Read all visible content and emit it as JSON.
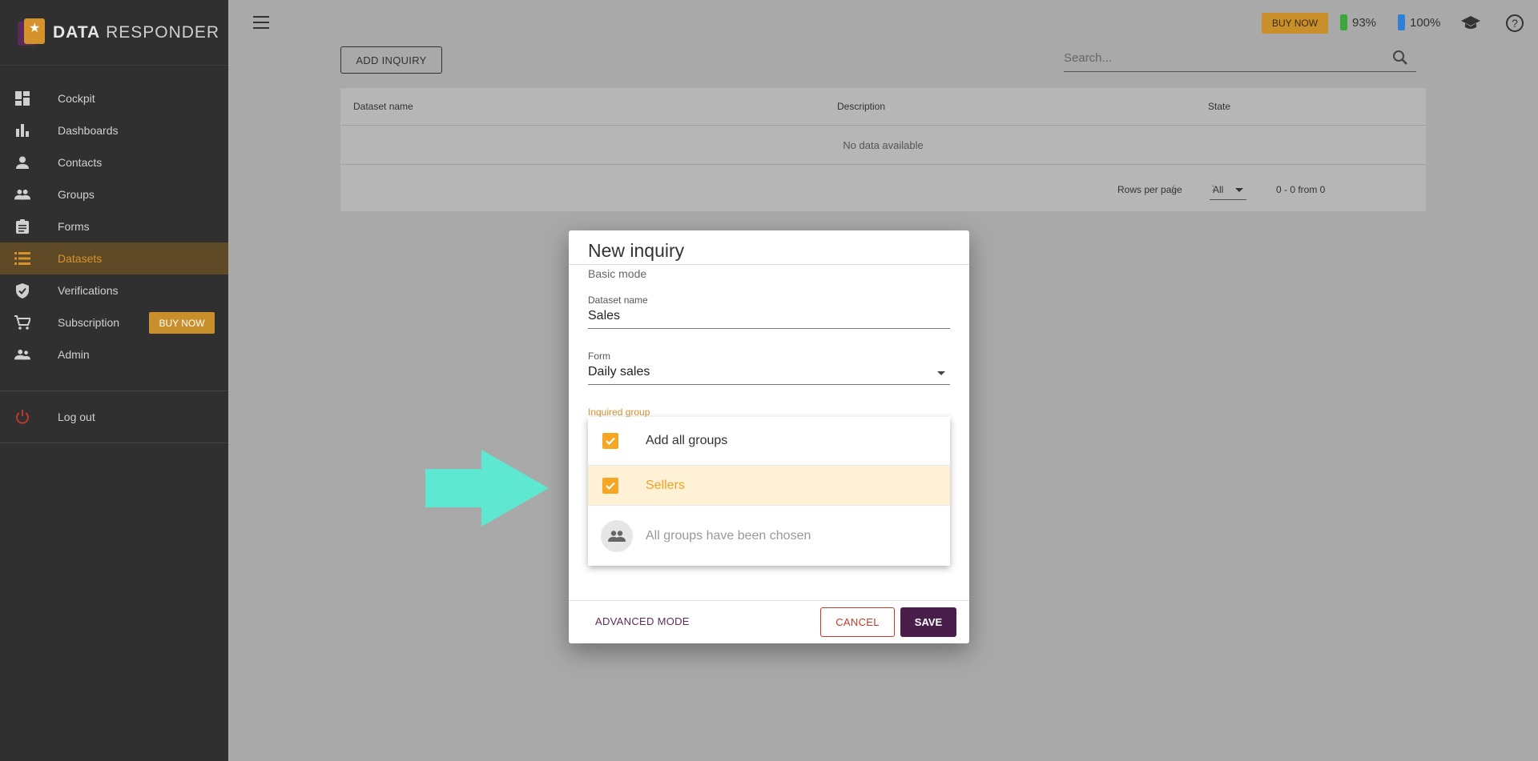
{
  "app": {
    "logo_bold": "DATA",
    "logo_light": "RESPONDER"
  },
  "sidebar": {
    "items": [
      {
        "label": "Cockpit",
        "icon": "dashboard-icon"
      },
      {
        "label": "Dashboards",
        "icon": "bar-chart-icon"
      },
      {
        "label": "Contacts",
        "icon": "person-icon"
      },
      {
        "label": "Groups",
        "icon": "people-icon"
      },
      {
        "label": "Forms",
        "icon": "clipboard-icon"
      },
      {
        "label": "Datasets",
        "icon": "list-icon",
        "active": true
      },
      {
        "label": "Verifications",
        "icon": "shield-check-icon"
      },
      {
        "label": "Subscription",
        "icon": "cart-icon"
      },
      {
        "label": "Admin",
        "icon": "admin-people-icon"
      }
    ],
    "subscription_buy": "BUY NOW",
    "logout": "Log out"
  },
  "topbar": {
    "buy_now": "BUY NOW",
    "battery1": "93%",
    "battery2": "100%",
    "battery1_color": "#3aa83a",
    "battery2_color": "#2f7fd8"
  },
  "main": {
    "add_inquiry": "ADD INQUIRY",
    "search_placeholder": "Search...",
    "table": {
      "columns": [
        "Dataset name",
        "Description",
        "State"
      ],
      "empty": "No data available",
      "rows_per_page_label": "Rows per page",
      "rows_per_page_value": "All",
      "range": "0 - 0 from 0"
    }
  },
  "dialog": {
    "title": "New inquiry",
    "mode": "Basic mode",
    "dataset_name_label": "Dataset name",
    "dataset_name_value": "Sales",
    "form_label": "Form",
    "form_value": "Daily sales",
    "inquired_group_label": "Inquired group",
    "menu": {
      "add_all": "Add all groups",
      "selected_item": "Sellers",
      "empty_note": "All groups have been chosen"
    },
    "advanced_mode": "ADVANCED MODE",
    "cancel": "CANCEL",
    "save": "SAVE"
  },
  "colors": {
    "accent": "#d6932c",
    "primary": "#4a1e4a",
    "arrow": "#5ee8d2"
  }
}
